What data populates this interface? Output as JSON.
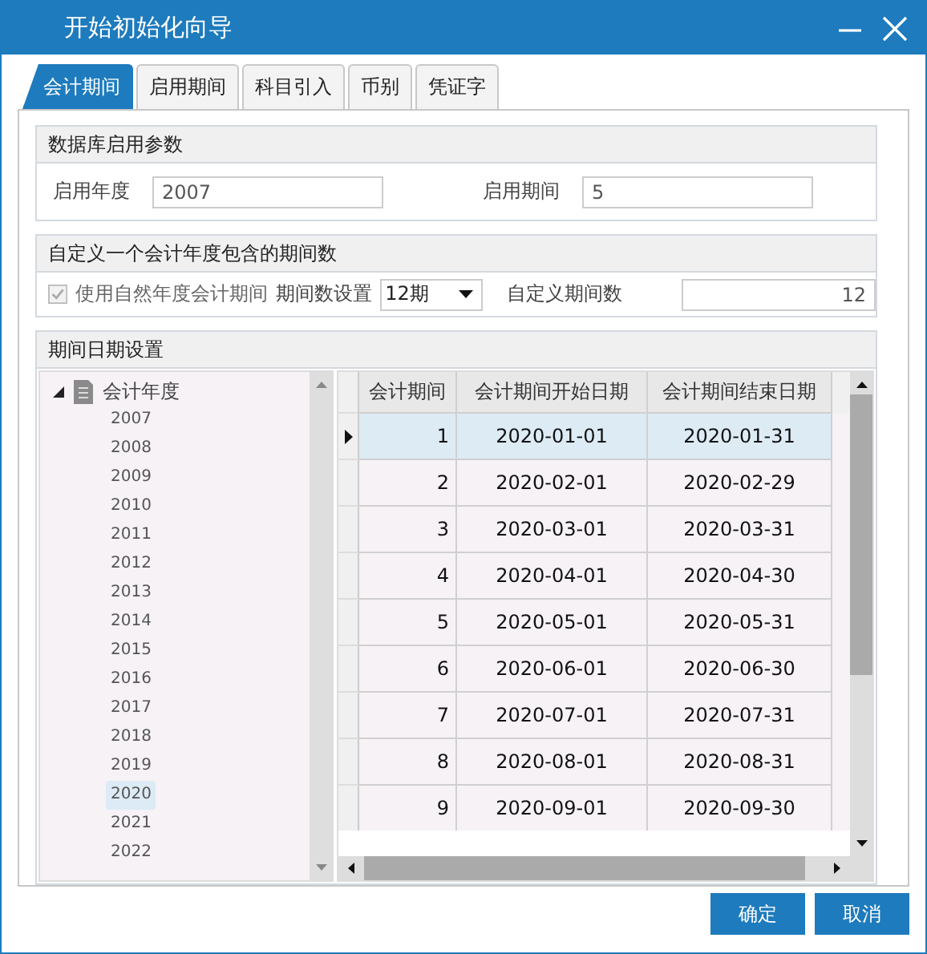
{
  "window": {
    "title": "开始初始化向导"
  },
  "tabs": [
    {
      "label": "会计期间",
      "selected": true
    },
    {
      "label": "启用期间",
      "selected": false
    },
    {
      "label": "科目引入",
      "selected": false
    },
    {
      "label": "币别",
      "selected": false
    },
    {
      "label": "凭证字",
      "selected": false
    }
  ],
  "db_params": {
    "title": "数据库启用参数",
    "year_label": "启用年度",
    "year_value": "2007",
    "period_label": "启用期间",
    "period_value": "5"
  },
  "period_count": {
    "title": "自定义一个会计年度包含的期间数",
    "natural_year": {
      "label": "使用自然年度会计期间",
      "checked": true,
      "disabled": true
    },
    "setting_label": "期间数设置",
    "setting_value": "12期",
    "custom_label": "自定义期间数",
    "custom_value": "12"
  },
  "date_settings": {
    "title": "期间日期设置",
    "tree": {
      "label": "会计年度",
      "expanded": true,
      "children": [
        {
          "label": "2007",
          "selected": false
        },
        {
          "label": "2008",
          "selected": false
        },
        {
          "label": "2009",
          "selected": false
        },
        {
          "label": "2010",
          "selected": false
        },
        {
          "label": "2011",
          "selected": false
        },
        {
          "label": "2012",
          "selected": false
        },
        {
          "label": "2013",
          "selected": false
        },
        {
          "label": "2014",
          "selected": false
        },
        {
          "label": "2015",
          "selected": false
        },
        {
          "label": "2016",
          "selected": false
        },
        {
          "label": "2017",
          "selected": false
        },
        {
          "label": "2018",
          "selected": false
        },
        {
          "label": "2019",
          "selected": false
        },
        {
          "label": "2020",
          "selected": true
        },
        {
          "label": "2021",
          "selected": false
        },
        {
          "label": "2022",
          "selected": false
        }
      ]
    },
    "table": {
      "columns": [
        "会计期间",
        "会计期间开始日期",
        "会计期间结束日期"
      ],
      "rows": [
        {
          "cells": [
            "1",
            "2020-01-01",
            "2020-01-31"
          ],
          "selected": true
        },
        {
          "cells": [
            "2",
            "2020-02-01",
            "2020-02-29"
          ],
          "selected": false
        },
        {
          "cells": [
            "3",
            "2020-03-01",
            "2020-03-31"
          ],
          "selected": false
        },
        {
          "cells": [
            "4",
            "2020-04-01",
            "2020-04-30"
          ],
          "selected": false
        },
        {
          "cells": [
            "5",
            "2020-05-01",
            "2020-05-31"
          ],
          "selected": false
        },
        {
          "cells": [
            "6",
            "2020-06-01",
            "2020-06-30"
          ],
          "selected": false
        },
        {
          "cells": [
            "7",
            "2020-07-01",
            "2020-07-31"
          ],
          "selected": false
        },
        {
          "cells": [
            "8",
            "2020-08-01",
            "2020-08-31"
          ],
          "selected": false
        },
        {
          "cells": [
            "9",
            "2020-09-01",
            "2020-09-30"
          ],
          "selected": false
        }
      ]
    }
  },
  "buttons": [
    "确定",
    "取消"
  ]
}
